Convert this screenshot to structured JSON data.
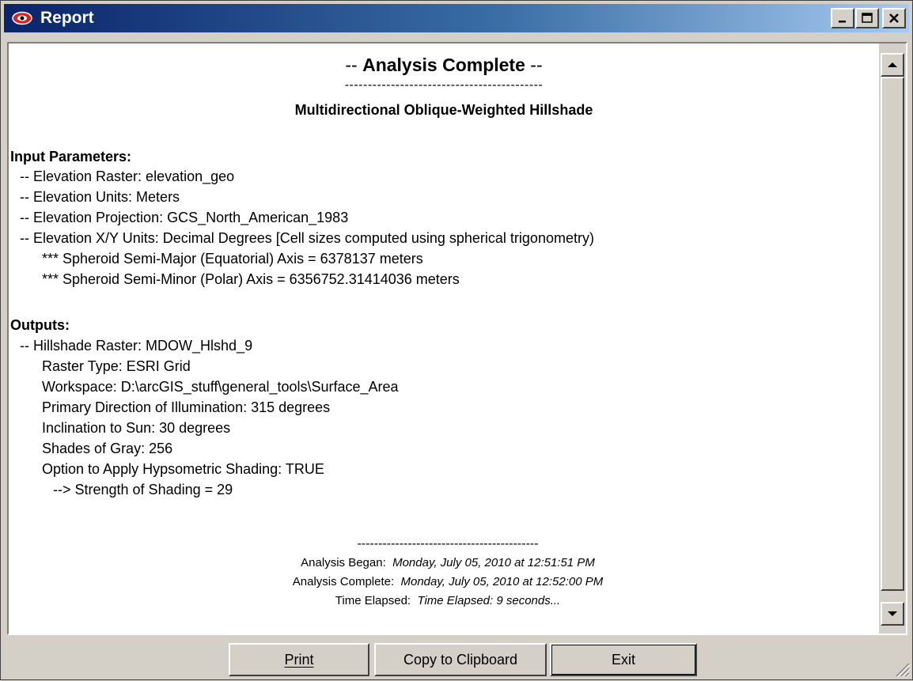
{
  "window": {
    "title": "Report",
    "icon": "eye-icon",
    "minimize_icon": "minimize-icon",
    "maximize_icon": "maximize-icon",
    "close_icon": "close-icon"
  },
  "report": {
    "heading": "-- Analysis Complete --",
    "heading_prefix": "-- ",
    "heading_main": "Analysis Complete",
    "heading_suffix": " --",
    "separator": "-------------------------------------------",
    "subtitle": "Multidirectional Oblique-Weighted Hillshade",
    "input_title": "Input Parameters:",
    "input_lines": [
      "-- Elevation Raster:  elevation_geo",
      "-- Elevation Units:  Meters",
      "-- Elevation Projection:  GCS_North_American_1983",
      "-- Elevation X/Y Units:  Decimal Degrees [Cell sizes computed using spherical trigonometry)",
      "*** Spheroid Semi-Major (Equatorial) Axis = 6378137 meters",
      "*** Spheroid Semi-Minor (Polar) Axis = 6356752.31414036 meters"
    ],
    "output_title": "Outputs:",
    "output_lines": [
      "-- Hillshade Raster:  MDOW_Hlshd_9",
      "Raster Type:  ESRI Grid",
      "Workspace:  D:\\arcGIS_stuff\\general_tools\\Surface_Area",
      "Primary Direction of Illumination:  315 degrees",
      "Inclination to Sun:  30 degrees",
      "Shades of Gray:  256",
      "Option to Apply Hypsometric Shading:  TRUE",
      "--> Strength of Shading = 29"
    ],
    "footer_separator": "-------------------------------------------",
    "began_label": "Analysis Began:",
    "began_value": "Monday, July 05, 2010 at 12:51:51 PM",
    "complete_label": "Analysis Complete:",
    "complete_value": "Monday, July 05, 2010 at 12:52:00 PM",
    "elapsed_label": "Time Elapsed:",
    "elapsed_value": "Time Elapsed: 9 seconds..."
  },
  "buttons": {
    "print": "Print",
    "copy": "Copy to Clipboard",
    "exit": "Exit"
  },
  "colors": {
    "title_bar_start": "#0a246a",
    "title_bar_end": "#a6caf0",
    "face": "#d4d0c8",
    "icon_red": "#e02020"
  }
}
